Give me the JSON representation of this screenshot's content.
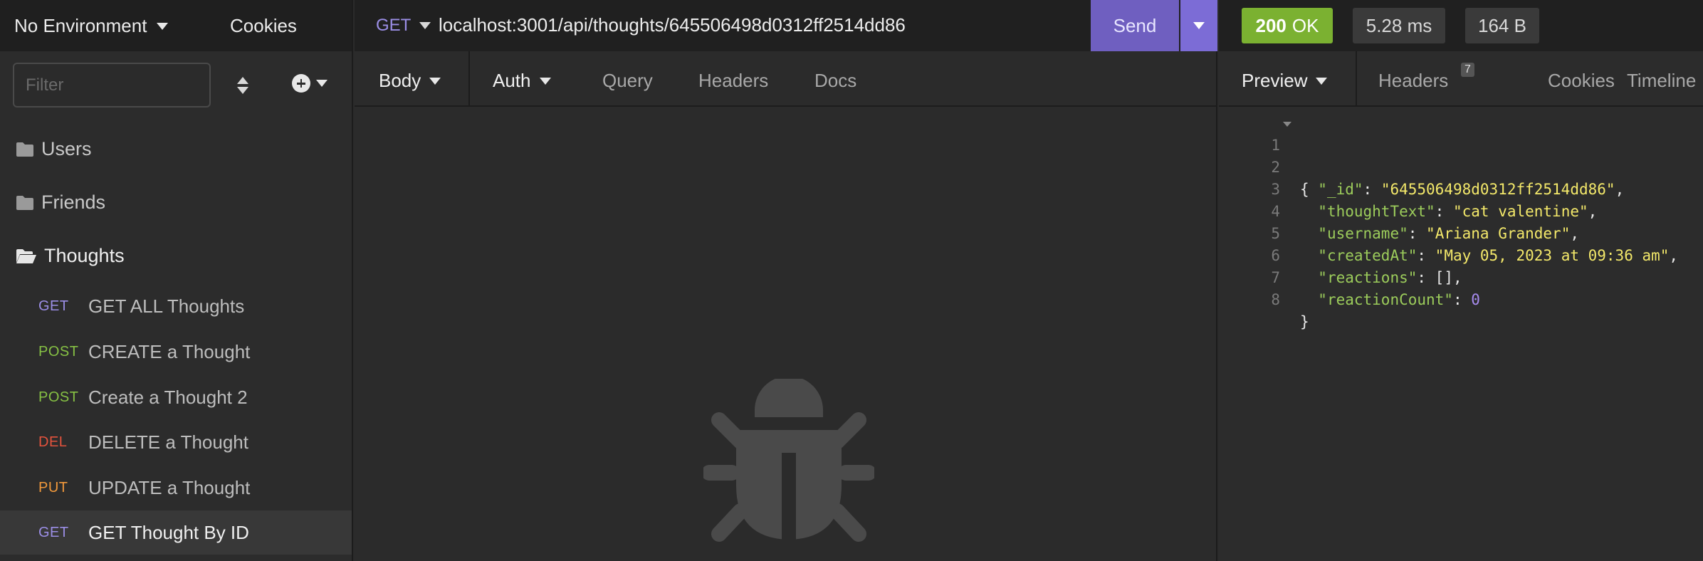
{
  "sidebar": {
    "environment": "No Environment",
    "cookies": "Cookies",
    "filter_placeholder": "Filter",
    "folders": {
      "users": "Users",
      "friends": "Friends",
      "thoughts": "Thoughts"
    },
    "requests": [
      {
        "method": "GET",
        "name": "GET ALL Thoughts",
        "color": "#9b8ee6"
      },
      {
        "method": "POST",
        "name": "CREATE a Thought",
        "color": "#86c144"
      },
      {
        "method": "POST",
        "name": "Create a Thought 2",
        "color": "#86c144"
      },
      {
        "method": "DEL",
        "name": "DELETE a Thought",
        "color": "#e5533d"
      },
      {
        "method": "PUT",
        "name": "UPDATE a Thought",
        "color": "#f2993b"
      },
      {
        "method": "GET",
        "name": "GET Thought By ID",
        "color": "#9b8ee6",
        "active": true
      }
    ]
  },
  "request": {
    "method": "GET",
    "url": "localhost:3001/api/thoughts/645506498d0312ff2514dd86",
    "send_label": "Send",
    "tabs": {
      "body": "Body",
      "auth": "Auth",
      "query": "Query",
      "headers": "Headers",
      "docs": "Docs"
    }
  },
  "response": {
    "status_code": "200",
    "status_text": "OK",
    "time": "5.28 ms",
    "size": "164 B",
    "tabs": {
      "preview": "Preview",
      "headers": "Headers",
      "headers_count": "7",
      "cookies": "Cookies",
      "timeline": "Timeline"
    },
    "line_numbers": [
      "1",
      "2",
      "3",
      "4",
      "5",
      "6",
      "7",
      "8"
    ],
    "json": {
      "_id": "645506498d0312ff2514dd86",
      "thoughtText": "cat valentine",
      "username": "Ariana Grander",
      "createdAt": "May 05, 2023 at 09:36 am",
      "reactions": "[]",
      "reactionCount": "0"
    }
  },
  "colors": {
    "accent": "#7c6cd6",
    "status_ok": "#7bb131"
  }
}
